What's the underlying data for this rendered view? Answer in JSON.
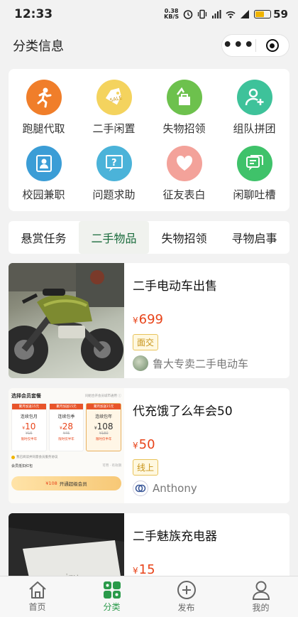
{
  "status_bar": {
    "time": "12:33",
    "net_speed": "0.38",
    "net_unit": "KB/S",
    "battery": "59"
  },
  "nav": {
    "title": "分类信息",
    "more_icon": "more-dots-icon",
    "close_icon": "target-circle-icon"
  },
  "categories": [
    {
      "label": "跑腿代取",
      "icon": "runner-icon",
      "color": "#f07e2a"
    },
    {
      "label": "二手闲置",
      "icon": "price-tag-icon",
      "color": "#f4d35e"
    },
    {
      "label": "失物招领",
      "icon": "lost-found-icon",
      "color": "#6dc14d"
    },
    {
      "label": "组队拼团",
      "icon": "add-user-icon",
      "color": "#3ec29a"
    },
    {
      "label": "校园兼职",
      "icon": "id-card-icon",
      "color": "#3b9dd6"
    },
    {
      "label": "问题求助",
      "icon": "question-icon",
      "color": "#4bb3d9"
    },
    {
      "label": "征友表白",
      "icon": "heart-icon",
      "color": "#f3a29a"
    },
    {
      "label": "闲聊吐槽",
      "icon": "chat-icon",
      "color": "#3fc26a"
    }
  ],
  "tabs": [
    {
      "label": "悬赏任务",
      "active": false
    },
    {
      "label": "二手物品",
      "active": true
    },
    {
      "label": "失物招领",
      "active": false
    },
    {
      "label": "寻物启事",
      "active": false
    }
  ],
  "items": [
    {
      "title": "二手电动车出售",
      "currency": "¥",
      "price": "699",
      "tag": "面交",
      "seller": "鲁大专卖二手电动车",
      "image": "electric-scooter-photo"
    },
    {
      "title": "代充饿了么年会50",
      "currency": "¥",
      "price": "50",
      "tag": "线上",
      "seller": "Anthony",
      "image": "membership-screenshot",
      "shot": {
        "heading": "选择会员套餐",
        "note": "同组合开会员城市通用 ⓘ",
        "plans": [
          {
            "badge": "聚月加送15元",
            "name": "连续包月",
            "price": "10",
            "old": "¥15",
            "tip": "限时仅半年"
          },
          {
            "badge": "聚月加送15元",
            "name": "连续包季",
            "price": "28",
            "old": "¥45",
            "tip": "限时仅半年"
          },
          {
            "badge": "聚月加送15元",
            "name": "连续包年",
            "price": "108",
            "old": "¥180",
            "tip": "限时仅半年"
          }
        ],
        "agree": "我已阅读并同意会员服务协议",
        "section": "会员抵扣红包",
        "section_right": "可用 · 有效期",
        "cta_price": "108",
        "cta": "开通超级会员"
      }
    },
    {
      "title": "二手魅族充电器",
      "currency": "¥",
      "price": "15",
      "tag": "",
      "seller": "",
      "image": "charger-photo",
      "brand": "meizu"
    }
  ],
  "tabbar": [
    {
      "label": "首页",
      "icon": "home-icon",
      "active": false
    },
    {
      "label": "分类",
      "icon": "grid-icon",
      "active": true
    },
    {
      "label": "发布",
      "icon": "plus-circle-icon",
      "active": false
    },
    {
      "label": "我的",
      "icon": "person-icon",
      "active": false
    }
  ],
  "colors": {
    "price": "#e8441a",
    "active_tab": "#1a6b3c",
    "tabbar_active": "#2a9a4a"
  }
}
